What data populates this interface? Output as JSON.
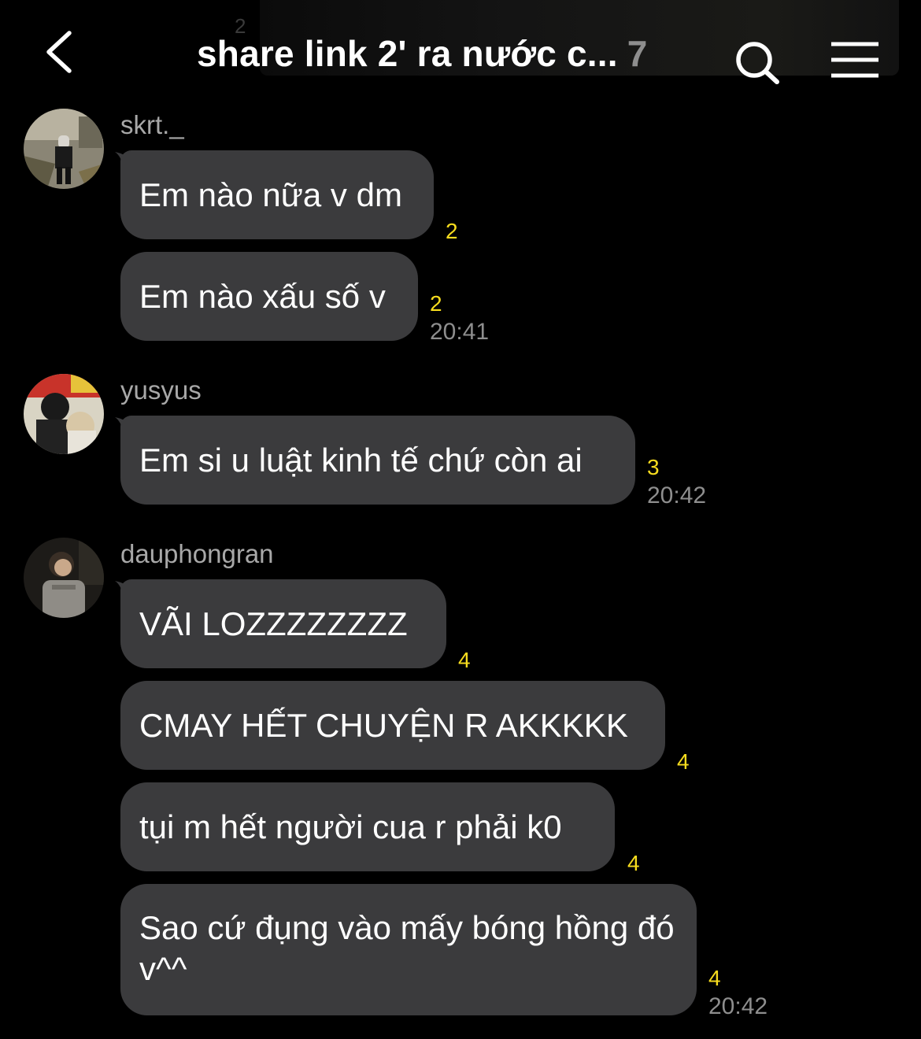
{
  "header": {
    "title": "share link 2' ra nước c...",
    "member_count": "7",
    "ghost_badge": "2"
  },
  "colors": {
    "background": "#000000",
    "bubble": "#3b3b3d",
    "unread": "#f7dc1e",
    "muted": "#8e8e8e"
  },
  "icons": {
    "back": "chevron-left-icon",
    "search": "search-icon",
    "menu": "menu-icon"
  },
  "groups": [
    {
      "sender": "skrt._",
      "messages": [
        {
          "text": "Em nào nữa v dm",
          "unread": "2",
          "time": ""
        },
        {
          "text": "Em nào xấu số v",
          "unread": "2",
          "time": "20:41"
        }
      ]
    },
    {
      "sender": "yusyus",
      "messages": [
        {
          "text": "Em si u luật kinh tế chứ còn ai",
          "unread": "3",
          "time": "20:42"
        }
      ]
    },
    {
      "sender": "dauphongran",
      "messages": [
        {
          "text": "VÃI LOZZZZZZZZ",
          "unread": "4",
          "time": ""
        },
        {
          "text": "CMAY HẾT CHUYỆN R AKKKKK",
          "unread": "4",
          "time": ""
        },
        {
          "text": "tụi m hết người cua r phải k0",
          "unread": "4",
          "time": ""
        },
        {
          "text": "Sao cứ đụng vào mấy bóng hồng đó v^^",
          "unread": "4",
          "time": "20:42"
        }
      ]
    }
  ]
}
